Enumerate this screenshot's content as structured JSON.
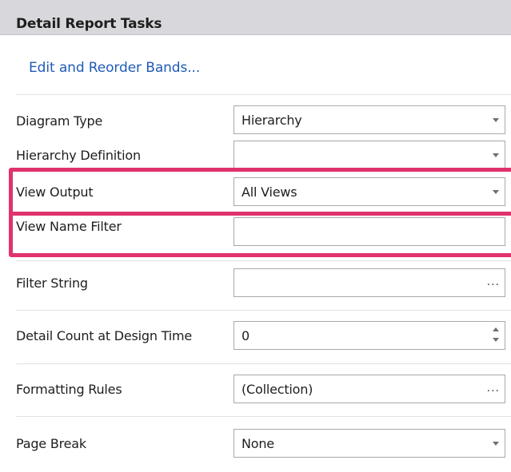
{
  "panel": {
    "title": "Detail Report Tasks",
    "link_label": "Edit and Reorder Bands..."
  },
  "properties": [
    {
      "label": "Diagram Type",
      "value": "Hierarchy",
      "control": "dropdown"
    },
    {
      "label": "Hierarchy Definition",
      "value": "",
      "control": "dropdown"
    },
    {
      "label": "View Output",
      "value": "All Views",
      "control": "dropdown"
    },
    {
      "label": "View Name Filter",
      "value": "",
      "control": "text"
    },
    {
      "label": "Filter String",
      "value": "",
      "control": "ellipsis",
      "button_label": "..."
    },
    {
      "label": "Detail Count at Design Time",
      "value": "0",
      "control": "spinner"
    },
    {
      "label": "Formatting Rules",
      "value": "(Collection)",
      "control": "ellipsis",
      "button_label": "..."
    },
    {
      "label": "Page Break",
      "value": "None",
      "control": "dropdown"
    }
  ],
  "icons": {
    "dropdown": "chevron-down-icon",
    "ellipsis": "ellipsis-icon",
    "spinner": "spinner-arrows-icon"
  },
  "colors": {
    "header_bg": "#d8d8dc",
    "link": "#1f5bb6",
    "highlight": "#e0336b"
  }
}
